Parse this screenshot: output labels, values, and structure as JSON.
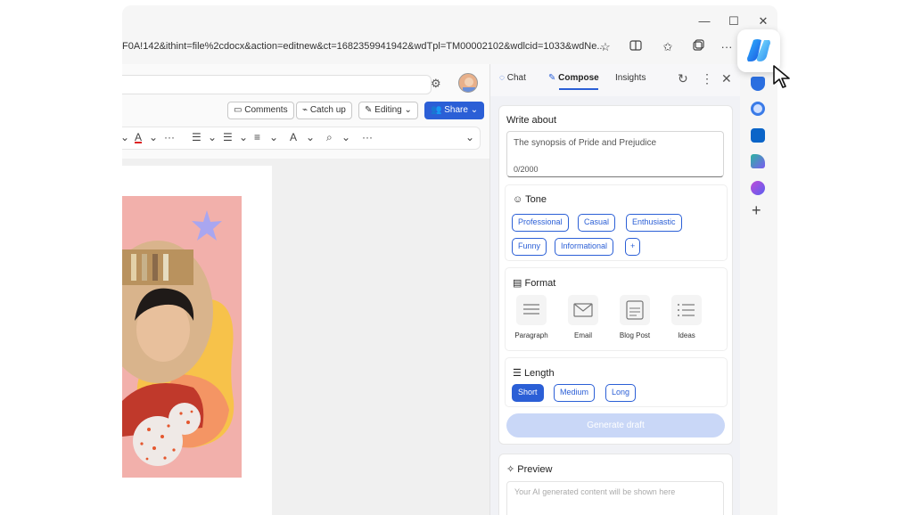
{
  "browser": {
    "address": "F0A!142&ithint=file%2cdocx&action=editnew&ct=1682359941942&wdTpl=TM00002102&wdlcid=1033&wdNe...",
    "window_controls": {
      "minimize": "—",
      "maximize": "☐",
      "close": "✕"
    }
  },
  "doc": {
    "toolbar": {
      "comments": "Comments",
      "catch_up": "Catch up",
      "editing": "Editing",
      "share": "Share"
    }
  },
  "panel": {
    "tabs": [
      "Chat",
      "Compose",
      "Insights"
    ],
    "active_tab": "Compose",
    "write_about": {
      "label": "Write about",
      "value": "The synopsis of Pride and Prejudice",
      "counter": "0/2000"
    },
    "tone": {
      "label": "Tone",
      "options": [
        "Professional",
        "Casual",
        "Enthusiastic",
        "Funny",
        "Informational"
      ],
      "add": "+"
    },
    "format": {
      "label": "Format",
      "options": [
        "Paragraph",
        "Email",
        "Blog Post",
        "Ideas"
      ]
    },
    "length": {
      "label": "Length",
      "options": [
        "Short",
        "Medium",
        "Long"
      ],
      "selected": "Short"
    },
    "generate": "Generate draft",
    "preview": {
      "label": "Preview",
      "placeholder": "Your AI generated content will be shown here"
    }
  },
  "colors": {
    "accent": "#2b5fd6",
    "image_bg": "#f2b0ab"
  }
}
